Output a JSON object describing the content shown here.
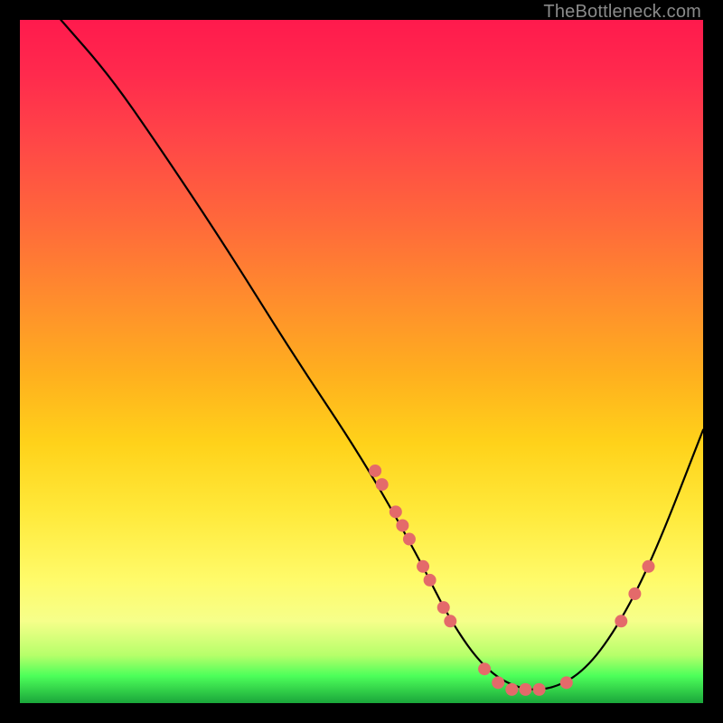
{
  "attribution": "TheBottleneck.com",
  "chart_data": {
    "type": "line",
    "title": "",
    "xlabel": "",
    "ylabel": "",
    "xlim": [
      0,
      100
    ],
    "ylim": [
      0,
      100
    ],
    "curve": [
      {
        "x": 6,
        "y": 100
      },
      {
        "x": 13,
        "y": 92
      },
      {
        "x": 20,
        "y": 82
      },
      {
        "x": 30,
        "y": 67
      },
      {
        "x": 40,
        "y": 51
      },
      {
        "x": 50,
        "y": 36
      },
      {
        "x": 58,
        "y": 22
      },
      {
        "x": 63,
        "y": 12
      },
      {
        "x": 68,
        "y": 5
      },
      {
        "x": 73,
        "y": 2
      },
      {
        "x": 78,
        "y": 2
      },
      {
        "x": 83,
        "y": 5
      },
      {
        "x": 88,
        "y": 12
      },
      {
        "x": 93,
        "y": 22
      },
      {
        "x": 100,
        "y": 40
      }
    ],
    "markers": [
      {
        "x": 52,
        "y": 34
      },
      {
        "x": 53,
        "y": 32
      },
      {
        "x": 55,
        "y": 28
      },
      {
        "x": 56,
        "y": 26
      },
      {
        "x": 57,
        "y": 24
      },
      {
        "x": 59,
        "y": 20
      },
      {
        "x": 60,
        "y": 18
      },
      {
        "x": 62,
        "y": 14
      },
      {
        "x": 63,
        "y": 12
      },
      {
        "x": 68,
        "y": 5
      },
      {
        "x": 70,
        "y": 3
      },
      {
        "x": 72,
        "y": 2
      },
      {
        "x": 74,
        "y": 2
      },
      {
        "x": 76,
        "y": 2
      },
      {
        "x": 80,
        "y": 3
      },
      {
        "x": 88,
        "y": 12
      },
      {
        "x": 90,
        "y": 16
      },
      {
        "x": 92,
        "y": 20
      }
    ],
    "marker_color": "#e46a6a",
    "background_gradient": {
      "top": "#ff1a4d",
      "mid": "#ffe93a",
      "bottom": "#1aa63a"
    }
  }
}
